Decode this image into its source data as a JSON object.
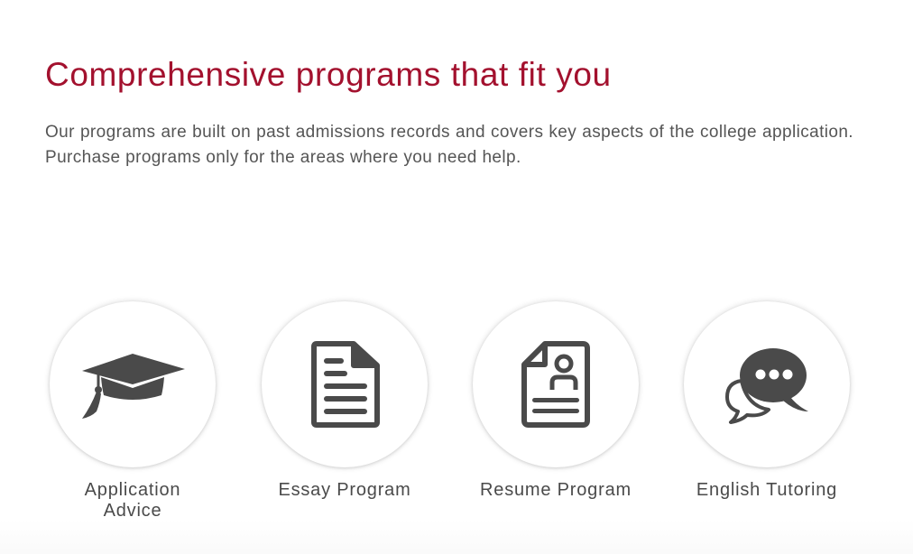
{
  "section": {
    "title": "Comprehensive programs that fit you",
    "description": "Our programs are built on past admissions records and covers key aspects of the college application. Purchase programs only for the areas where you need help."
  },
  "programs": [
    {
      "label": "Application Advice",
      "icon": "graduation-cap-icon"
    },
    {
      "label": "Essay Program",
      "icon": "document-icon"
    },
    {
      "label": "Resume Program",
      "icon": "resume-icon"
    },
    {
      "label": "English Tutoring",
      "icon": "chat-bubbles-icon"
    }
  ],
  "colors": {
    "heading": "#a3112e",
    "text": "#555555",
    "icon": "#4a4a4a",
    "circle_bg": "#ffffff"
  }
}
